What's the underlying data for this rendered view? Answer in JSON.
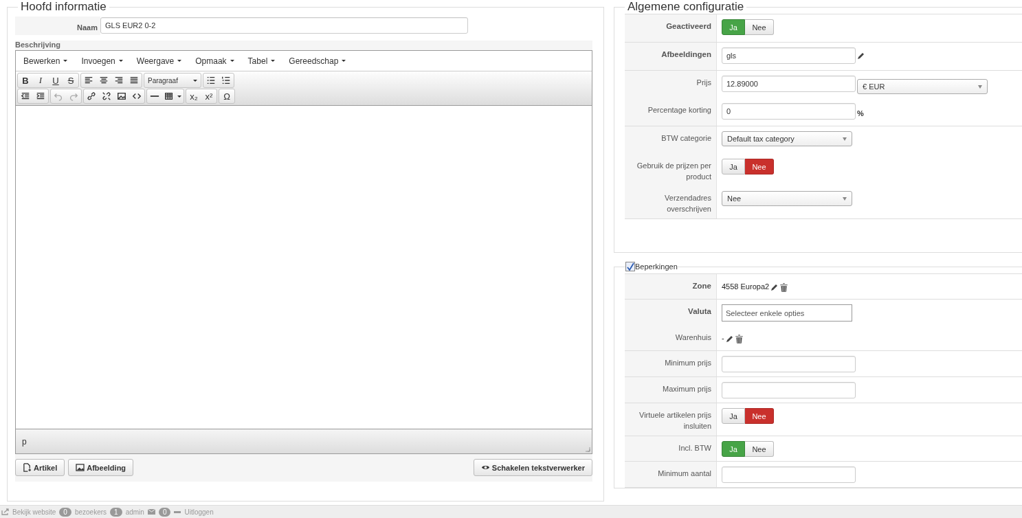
{
  "main_panel": {
    "title": "Hoofd informatie",
    "name_label": "Naam",
    "name_value": "GLS EUR2 0-2",
    "description_label": "Beschrijving",
    "editor": {
      "menus": [
        "Bewerken",
        "Invoegen",
        "Weergave",
        "Opmaak",
        "Tabel",
        "Gereedschap"
      ],
      "toolbar_rows": [
        [
          [
            {
              "kind": "bold",
              "label": "B"
            },
            {
              "kind": "italic",
              "label": "I"
            },
            {
              "kind": "underline",
              "label": "U"
            },
            {
              "kind": "strike",
              "label": "S"
            }
          ],
          [
            {
              "kind": "align-left"
            },
            {
              "kind": "align-center"
            },
            {
              "kind": "align-right"
            },
            {
              "kind": "justify"
            }
          ],
          [
            {
              "kind": "dropdown",
              "label": "Paragraaf"
            }
          ],
          [
            {
              "kind": "bullet-list"
            },
            {
              "kind": "numbered-list"
            }
          ]
        ],
        [
          [
            {
              "kind": "outdent"
            },
            {
              "kind": "indent"
            }
          ],
          [
            {
              "kind": "undo",
              "disabled": true
            },
            {
              "kind": "redo",
              "disabled": true
            }
          ],
          [
            {
              "kind": "link"
            },
            {
              "kind": "unlink"
            },
            {
              "kind": "image"
            },
            {
              "kind": "code"
            }
          ],
          [
            {
              "kind": "rule"
            },
            {
              "kind": "table"
            }
          ],
          [
            {
              "kind": "subscript",
              "label": "x₂"
            },
            {
              "kind": "superscript",
              "label": "x²"
            }
          ],
          [
            {
              "kind": "symbol",
              "label": "Ω"
            }
          ]
        ]
      ],
      "path": "p"
    },
    "buttons": [
      {
        "kind": "article",
        "label": "Artikel"
      },
      {
        "kind": "image",
        "label": "Afbeelding"
      }
    ],
    "toggle_button": {
      "label": "Schakelen tekstverwerker"
    }
  },
  "config_panel": {
    "title": "Algemene configuratie",
    "groups": [
      [
        {
          "label": "Geactiveerd",
          "bold": true,
          "kind": "toggle",
          "yes": "Ja",
          "no": "Nee",
          "on": true
        }
      ],
      [
        {
          "label": "Afbeeldingen",
          "bold": true,
          "kind": "input_edit",
          "value": "gls"
        }
      ],
      [
        {
          "label": "Prijs",
          "bold": false,
          "kind": "input_select",
          "value": "12.89000",
          "select": "€ EUR"
        },
        {
          "label": "Percentage korting",
          "bold": false,
          "kind": "input_suffix",
          "value": "0",
          "suffix": "%"
        }
      ],
      [
        {
          "label": "BTW categorie",
          "bold": false,
          "kind": "select",
          "value": "Default tax category"
        },
        {
          "label": "Gebruik de prijzen per product",
          "bold": false,
          "kind": "toggle",
          "yes": "Ja",
          "no": "Nee",
          "on": false
        },
        {
          "label": "Verzendadres overschrijven",
          "bold": false,
          "kind": "select",
          "value": "Nee"
        }
      ]
    ]
  },
  "restrictions_panel": {
    "title": "Beperkingen",
    "checked": true,
    "groups": [
      [
        {
          "label": "Zone",
          "bold": true,
          "kind": "value_actions",
          "value": "4558 Europa2"
        }
      ],
      [
        {
          "label": "Valuta",
          "bold": true,
          "kind": "multiselect",
          "placeholder": "Selecteer enkele opties"
        },
        {
          "label": "Warenhuis",
          "bold": false,
          "kind": "value_actions",
          "value": "-"
        }
      ],
      [
        {
          "label": "Minimum prijs",
          "bold": false,
          "kind": "input"
        }
      ],
      [
        {
          "label": "Maximum prijs",
          "bold": false,
          "kind": "input"
        }
      ],
      [
        {
          "label": "Virtuele artikelen prijs insluiten",
          "bold": false,
          "kind": "toggle",
          "yes": "Ja",
          "no": "Nee",
          "on": false
        }
      ],
      [
        {
          "label": "Incl. BTW",
          "bold": false,
          "kind": "toggle",
          "yes": "Ja",
          "no": "Nee",
          "on": true
        }
      ],
      [
        {
          "label": "Minimum aantal",
          "bold": false,
          "kind": "input"
        }
      ]
    ]
  },
  "status_bar": {
    "view_site": "Bekijk website",
    "visitors_count": "0",
    "visitors_label": "bezoekers",
    "admin_count": "1",
    "admin_label": "admin",
    "messages_count": "0",
    "logout": "Uitloggen"
  }
}
